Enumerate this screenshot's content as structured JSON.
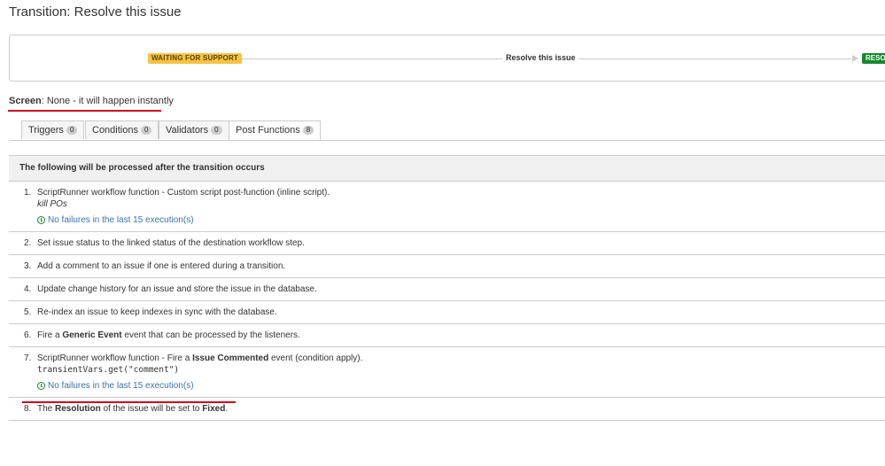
{
  "page": {
    "title": "Transition: Resolve this issue"
  },
  "flow": {
    "source_status": "WAITING FOR SUPPORT",
    "transition_name": "Resolve this issue",
    "target_status": "RESO",
    "colors": {
      "source_status_bg": "#f6c342",
      "target_status_bg": "#14892c"
    }
  },
  "screen": {
    "label": "Screen",
    "value": ": None - it will happen instantly"
  },
  "tabs": [
    {
      "label": "Triggers",
      "count": "0"
    },
    {
      "label": "Conditions",
      "count": "0"
    },
    {
      "label": "Validators",
      "count": "0"
    },
    {
      "label": "Post Functions",
      "count": "8",
      "active": true
    }
  ],
  "post_functions": {
    "header": "The following will be processed after the transition occurs",
    "items": [
      {
        "num": "1.",
        "text": "ScriptRunner workflow function - Custom script post-function (inline script).",
        "sub": "kill POs",
        "status": "No failures in the last 15 execution(s)"
      },
      {
        "num": "2.",
        "text": "Set issue status to the linked status of the destination workflow step."
      },
      {
        "num": "3.",
        "text": "Add a comment to an issue if one is entered during a transition."
      },
      {
        "num": "4.",
        "text": "Update change history for an issue and store the issue in the database."
      },
      {
        "num": "5.",
        "text": "Re-index an issue to keep indexes in sync with the database."
      },
      {
        "num": "6.",
        "pre": "Fire a ",
        "bold": "Generic Event",
        "post": " event that can be processed by the listeners."
      },
      {
        "num": "7.",
        "pre": "ScriptRunner workflow function - Fire a ",
        "bold": "Issue Commented",
        "post": " event (condition apply).",
        "code": "transientVars.get(\"comment\")",
        "status": "No failures in the last 15 execution(s)"
      },
      {
        "num": "8.",
        "pre": "The ",
        "bold": "Resolution",
        "mid": " of the issue will be set to ",
        "bold2": "Fixed",
        "post": "."
      }
    ]
  }
}
